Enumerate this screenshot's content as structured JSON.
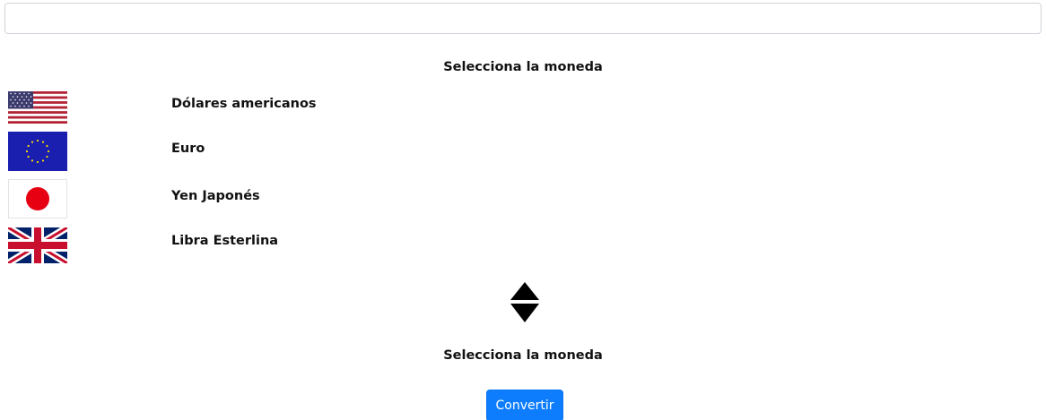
{
  "amount_input": {
    "value": "",
    "placeholder": ""
  },
  "from_heading": "Selecciona la moneda",
  "currencies": [
    {
      "label": "Dólares americanos",
      "flag_icon": "usa-flag-icon"
    },
    {
      "label": "Euro",
      "flag_icon": "eu-flag-icon"
    },
    {
      "label": "Yen Japonés",
      "flag_icon": "japan-flag-icon"
    },
    {
      "label": "Libra Esterlina",
      "flag_icon": "uk-flag-icon"
    }
  ],
  "swap_icon": "swap-updown-icon",
  "to_heading": "Selecciona la moneda",
  "convert_button": "Convertir",
  "colors": {
    "primary": "#0d7dfd",
    "input_border": "#ced4da"
  }
}
